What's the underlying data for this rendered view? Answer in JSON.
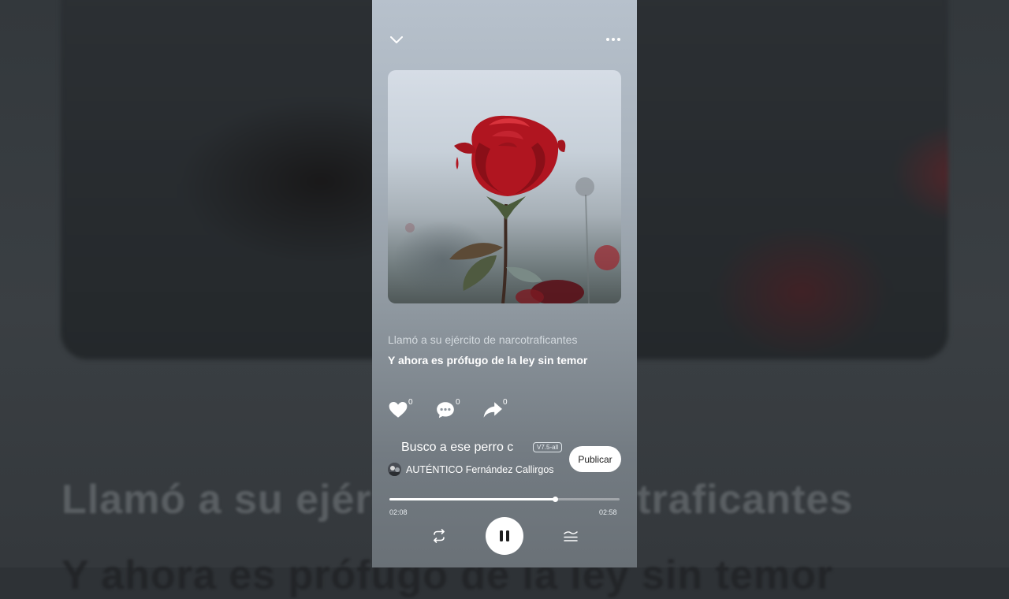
{
  "backdrop": {
    "lyric_previous": "Llamó a su ejército de narcotraficantes",
    "lyric_current": "Y ahora es prófugo de la ley sin temor"
  },
  "player": {
    "top_bar": {
      "collapse_icon": "chevron-down-icon",
      "more_icon": "more-dots-icon"
    },
    "lyrics": {
      "previous": "Llamó a su ejército de narcotraficantes",
      "current": "Y ahora es prófugo de la ley sin temor"
    },
    "actions": [
      {
        "icon": "heart-icon",
        "count": "0"
      },
      {
        "icon": "comment-icon",
        "count": "0"
      },
      {
        "icon": "share-icon",
        "count": "0"
      }
    ],
    "song": {
      "title": "Busco a ese perro c",
      "version_badge": "V7.5-all",
      "artist": "AUTÉNTICO Fernández Callirgos"
    },
    "publish_label": "Publicar",
    "progress": {
      "elapsed": "02:08",
      "total": "02:58",
      "fraction": 0.72
    },
    "controls": {
      "repeat_icon": "repeat-icon",
      "pause_icon": "pause-icon",
      "playlist_icon": "playlist-icon"
    },
    "colors": {
      "accent": "#ffffff",
      "rose": "#b01520"
    }
  }
}
